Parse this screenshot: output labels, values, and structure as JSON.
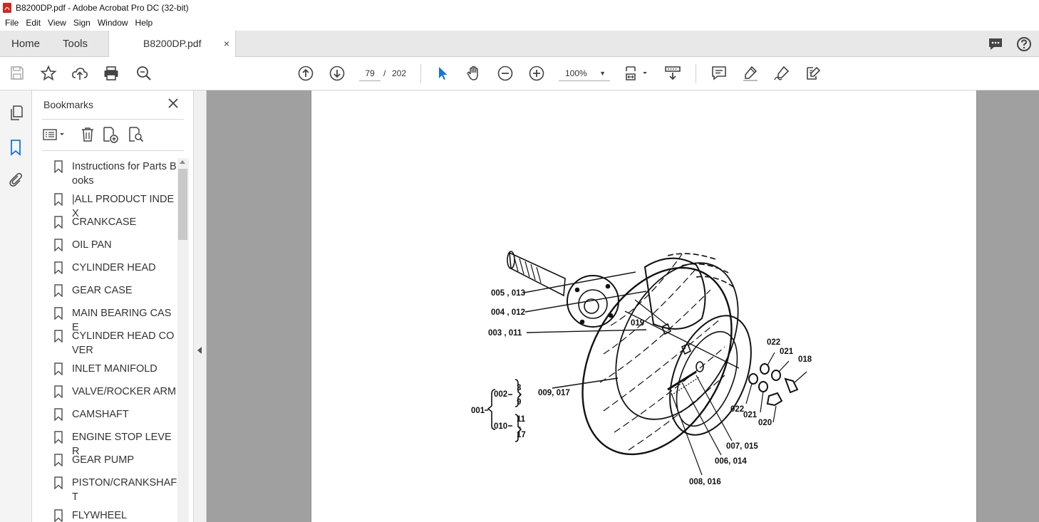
{
  "window": {
    "title": "B8200DP.pdf - Adobe Acrobat Pro DC (32-bit)",
    "app_icon": "acrobat-pdf-icon"
  },
  "menu": [
    "File",
    "Edit",
    "View",
    "Sign",
    "Window",
    "Help"
  ],
  "tabs": {
    "home": "Home",
    "tools": "Tools",
    "document": "B8200DP.pdf",
    "close_glyph": "×"
  },
  "toolbar": {
    "current_page": "79",
    "page_separator": "/",
    "total_pages": "202",
    "zoom": "100%",
    "icons": [
      "save-icon",
      "bookmark-star-icon",
      "cloud-upload-icon",
      "print-icon",
      "find-zoom-icon",
      "page-up-icon",
      "page-down-icon",
      "select-arrow-icon",
      "hand-icon",
      "zoom-out-icon",
      "zoom-in-icon",
      "fit-page-icon",
      "scroll-mode-icon",
      "comment-icon",
      "highlight-icon",
      "sign-icon",
      "edit-pdf-icon"
    ]
  },
  "bookmarks": {
    "header": "Bookmarks",
    "items": [
      "Instructions for Parts Books",
      "|ALL PRODUCT INDEX",
      "CRANKCASE",
      "OIL PAN",
      "CYLINDER HEAD",
      "GEAR CASE",
      "MAIN BEARING CASE",
      "CYLINDER HEAD COVER",
      "INLET MANIFOLD",
      "VALVE/ROCKER ARM",
      "CAMSHAFT",
      "ENGINE STOP LEVER",
      "GEAR PUMP",
      "PISTON/CRANKSHAFT",
      "FLYWHEEL"
    ]
  },
  "diagram": {
    "callouts": {
      "c005": "005 , 013",
      "c004": "004 , 012",
      "c003": "003 , 011",
      "c019": "019",
      "c022a": "022",
      "c021a": "021",
      "c018": "018",
      "c009": "009, 017",
      "c022b": "022",
      "c021b": "021",
      "c020": "020",
      "c007": "007, 015",
      "c006": "006, 014",
      "c008": "008, 016",
      "c001": "001",
      "c002": "002",
      "c010": "010",
      "n3": "3",
      "n9": "9",
      "n11": "11",
      "n17": "17",
      "comma1": ",",
      "comma2": ","
    }
  }
}
